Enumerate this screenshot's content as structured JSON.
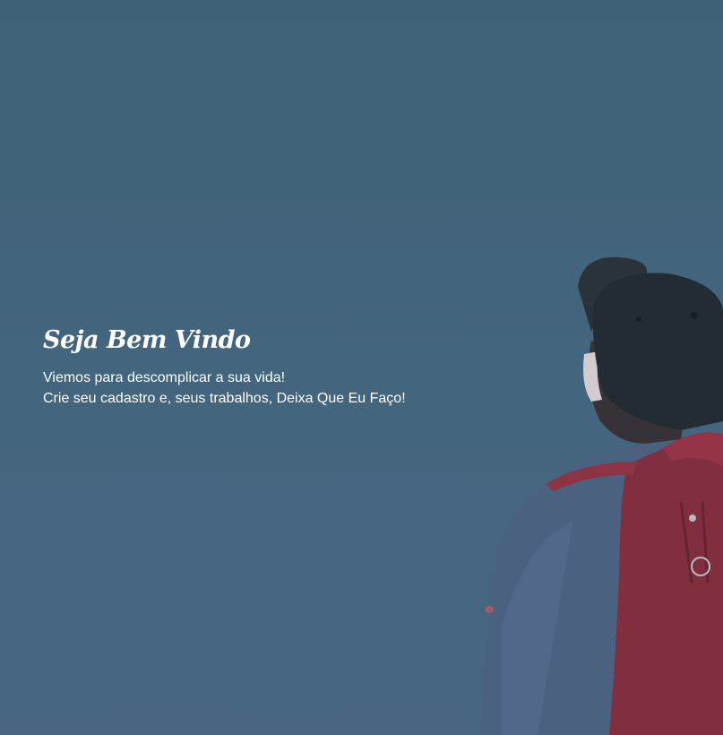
{
  "hero": {
    "title": "Seja Bem Vindo",
    "line1": "Viemos para descomplicar a sua vida!",
    "line2": "Crie seu cadastro e, seus trabalhos, Deixa Que Eu Faço!",
    "colors": {
      "background": "#4a6a84",
      "text": "#ffffff",
      "backpack": "#8e2c3a",
      "jacket": "#4f6584",
      "cap": "#23272d"
    }
  }
}
